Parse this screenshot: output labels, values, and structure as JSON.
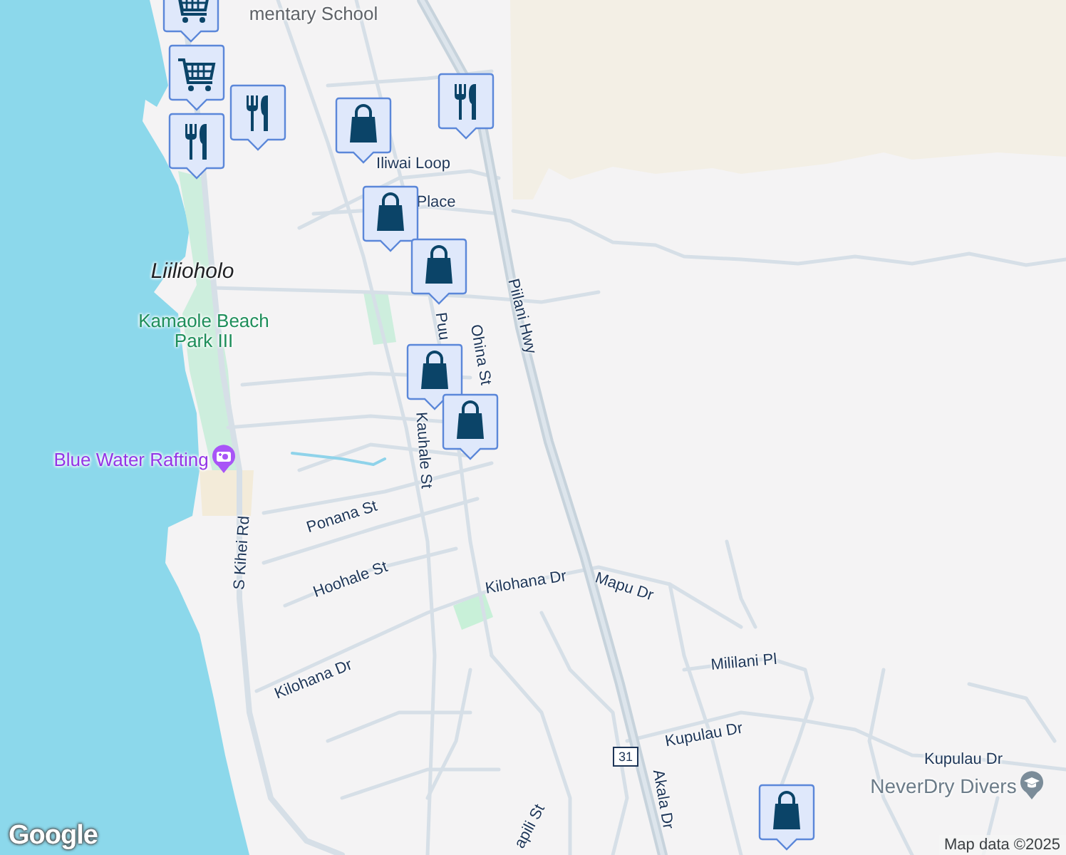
{
  "map": {
    "labels": [
      {
        "text": "mentary School",
        "kind": "poi"
      },
      {
        "text": "Iliwai Loop",
        "kind": "street"
      },
      {
        "text": "Place",
        "kind": "street"
      },
      {
        "text": "Piilani Hwy",
        "kind": "street"
      },
      {
        "text": "Liilioholo",
        "kind": "area"
      },
      {
        "text": "Kamaole Beach Park III",
        "kind": "park"
      },
      {
        "text": "Puu",
        "kind": "street"
      },
      {
        "text": "Ohina St",
        "kind": "street"
      },
      {
        "text": "Kauhale St",
        "kind": "street"
      },
      {
        "text": "Blue Water Rafting",
        "kind": "attraction"
      },
      {
        "text": "S Kihei Rd",
        "kind": "street"
      },
      {
        "text": "Ponana St",
        "kind": "street"
      },
      {
        "text": "Hoohale St",
        "kind": "street"
      },
      {
        "text": "Kilohana Dr",
        "kind": "street"
      },
      {
        "text": "Mapu Dr",
        "kind": "street"
      },
      {
        "text": "Kilohana Dr",
        "kind": "street"
      },
      {
        "text": "Mililani Pl",
        "kind": "street"
      },
      {
        "text": "Kupulau Dr",
        "kind": "street"
      },
      {
        "text": "Kupulau Dr",
        "kind": "street"
      },
      {
        "text": "Akala Dr",
        "kind": "street"
      },
      {
        "text": "NeverDry Divers",
        "kind": "school"
      },
      {
        "text": "apili St",
        "kind": "street"
      }
    ],
    "pins": [
      {
        "kind": "grocery"
      },
      {
        "kind": "grocery"
      },
      {
        "kind": "restaurant"
      },
      {
        "kind": "restaurant"
      },
      {
        "kind": "shopping"
      },
      {
        "kind": "restaurant"
      },
      {
        "kind": "shopping"
      },
      {
        "kind": "shopping"
      },
      {
        "kind": "shopping"
      },
      {
        "kind": "shopping"
      },
      {
        "kind": "shopping"
      }
    ],
    "route_shield": "31",
    "logo": "Google",
    "attribution": "Map data ©2025"
  }
}
